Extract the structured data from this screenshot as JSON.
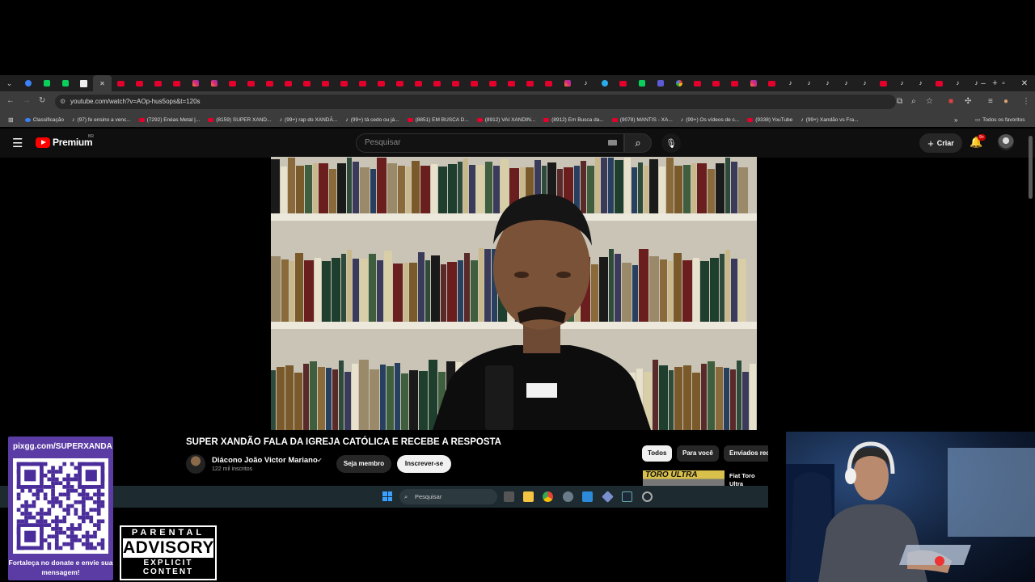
{
  "browser": {
    "url": "youtube.com/watch?v=AOp-hus5ops&t=120s",
    "bookmarks": [
      {
        "label": "Classificação",
        "icon": "bl"
      },
      {
        "label": "(97) fe ensino a venc...",
        "icon": "tt"
      },
      {
        "label": "(7292) Enéas Metal |...",
        "icon": "yt"
      },
      {
        "label": "(8159) SUPER XAND...",
        "icon": "yt"
      },
      {
        "label": "(99+) rap do XANDÃ...",
        "icon": "tt"
      },
      {
        "label": "(99+) tá cedo ou já...",
        "icon": "tt"
      },
      {
        "label": "(8851) EM BUSCA D...",
        "icon": "yt"
      },
      {
        "label": "(8912) VAI XANDIN...",
        "icon": "yt"
      },
      {
        "label": "(8912) Em Busca da...",
        "icon": "yt"
      },
      {
        "label": "(9078) MANTIS - XA...",
        "icon": "yt"
      },
      {
        "label": "(99+) Os vídeos de c...",
        "icon": "tt"
      },
      {
        "label": "(9338) YouTube",
        "icon": "yt"
      },
      {
        "label": "(99+) Xandão vs Fra...",
        "icon": "tt"
      }
    ],
    "all_bookmarks": "Todos os favoritos",
    "new_tab": "+",
    "win_min": "–",
    "win_max": "▫",
    "win_close": "✕"
  },
  "youtube": {
    "logo_text": "Premium",
    "region": "BR",
    "search_placeholder": "Pesquisar",
    "create_label": "Criar",
    "notif_count": "9+",
    "video_title": "SUPER XANDÃO FALA DA IGREJA CATÓLICA E RECEBE A RESPOSTA",
    "channel_name": "Diácono João Victor Mariano",
    "subscribers": "122 mil inscritos",
    "member_label": "Seja membro",
    "subscribe_label": "Inscrever-se",
    "chips": [
      "Todos",
      "Para você",
      "Enviados rec"
    ],
    "ad_thumb_text": "TORO ULTRA",
    "ad_title": "Fiat Toro Ultra RAMPAGE o"
  },
  "taskbar": {
    "search_label": "Pesquisar"
  },
  "overlay": {
    "qr_url": "pixgg.com/SUPERXANDA",
    "qr_cta": "Fortaleça no donate e envie sua mensagem!",
    "advisory_line1": "PARENTAL",
    "advisory_line2": "ADVISORY",
    "advisory_line3": "EXPLICIT CONTENT"
  }
}
